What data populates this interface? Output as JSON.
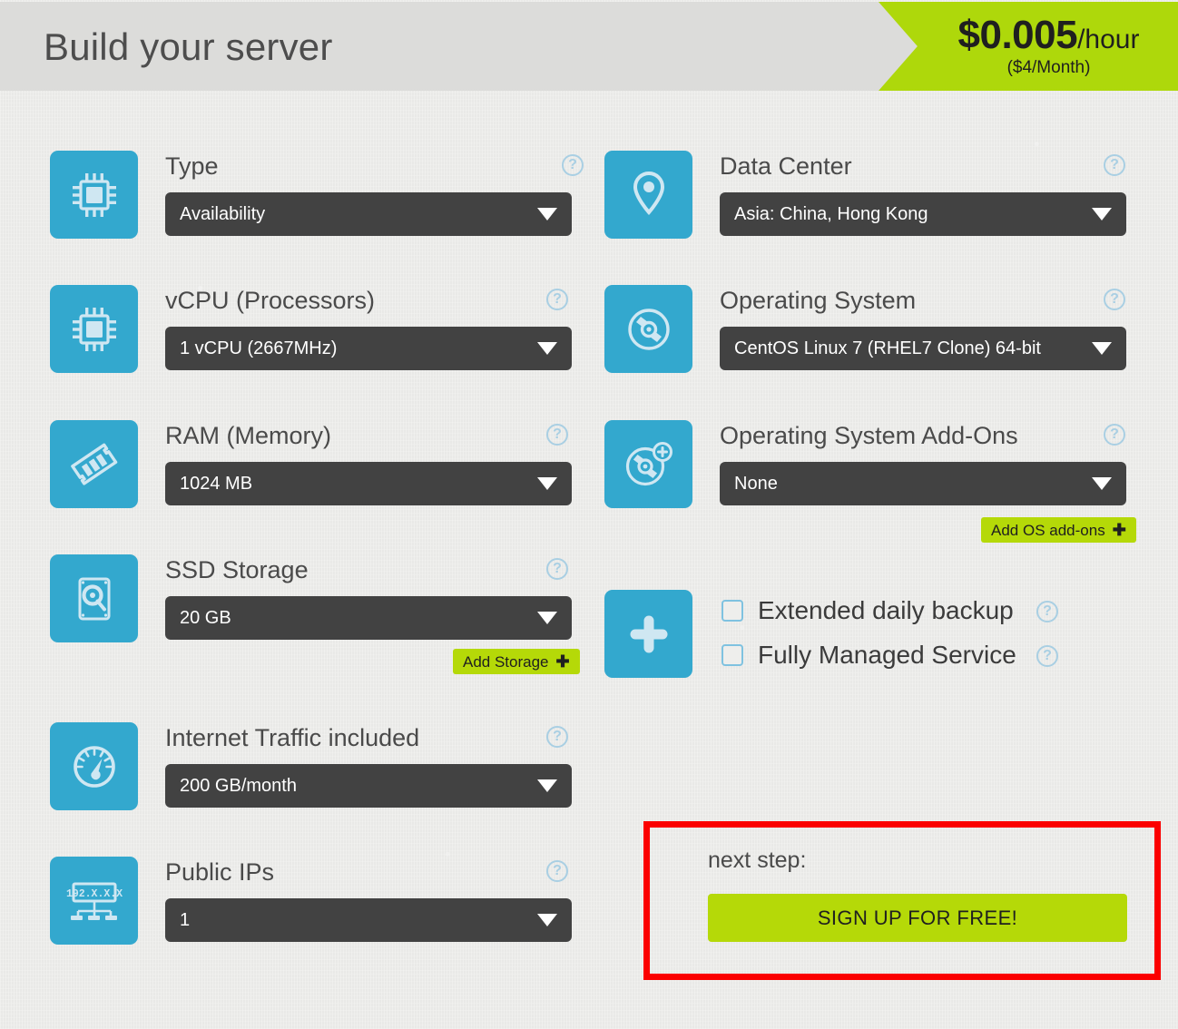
{
  "header": {
    "title": "Build your server",
    "price": {
      "amount": "$0.005",
      "unit": "/hour",
      "sub_amount": "$4",
      "sub_unit": "/Month)",
      "sub_open": "(",
      "sub_full": "($4/Month)"
    }
  },
  "help_glyph": "?",
  "left_column": [
    {
      "key": "type",
      "icon": "cpu-chip-icon",
      "label": "Type",
      "value": "Availability"
    },
    {
      "key": "vcpu",
      "icon": "cpu-chip-icon",
      "label": "vCPU (Processors)",
      "value": "1 vCPU (2667MHz)"
    },
    {
      "key": "ram",
      "icon": "ram-stick-icon",
      "label": "RAM (Memory)",
      "value": "1024 MB"
    },
    {
      "key": "ssd",
      "icon": "hard-drive-icon",
      "label": "SSD Storage",
      "value": "20 GB",
      "action": "Add Storage"
    },
    {
      "key": "traffic",
      "icon": "speedometer-icon",
      "label": "Internet Traffic included",
      "value": "200 GB/month"
    },
    {
      "key": "public_ips",
      "icon": "network-ip-icon",
      "label": "Public IPs",
      "value": "1",
      "icon_text": "192.X.X.X"
    }
  ],
  "right_column": [
    {
      "key": "datacenter",
      "icon": "map-pin-icon",
      "label": "Data Center",
      "value": "Asia: China, Hong Kong"
    },
    {
      "key": "os",
      "icon": "disc-icon",
      "label": "Operating System",
      "value": "CentOS Linux 7 (RHEL7 Clone) 64-bit"
    },
    {
      "key": "os_addons",
      "icon": "disc-plus-icon",
      "label": "Operating System Add-Ons",
      "value": "None",
      "action": "Add OS add-ons"
    }
  ],
  "extras": {
    "icon": "plus-icon",
    "options": [
      {
        "key": "extended_backup",
        "label": "Extended daily backup",
        "checked": false
      },
      {
        "key": "managed_service",
        "label": "Fully Managed Service",
        "checked": false
      }
    ]
  },
  "next_step": {
    "label": "next step:",
    "button": "SIGN UP FOR FREE!"
  },
  "action_plus_glyph": "✚",
  "colors": {
    "accent_blue": "#33a8ce",
    "accent_green": "#b5d908",
    "banner_green": "#aed80b",
    "select_dark": "#424242",
    "page_bg": "#e9e9e7",
    "header_bg": "#dcdcda",
    "highlight_red": "#fb0000"
  }
}
